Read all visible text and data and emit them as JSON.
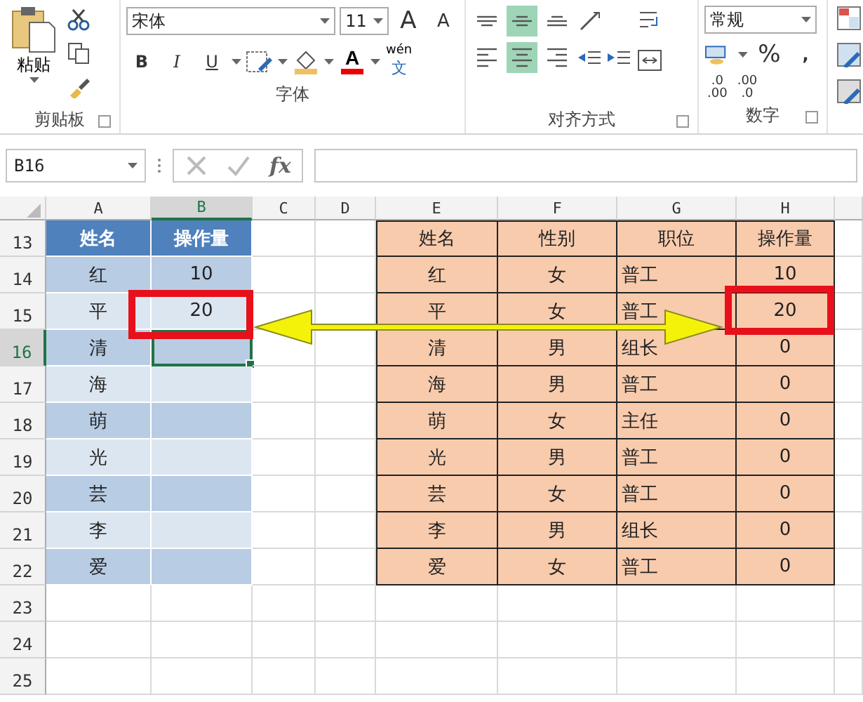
{
  "ribbon": {
    "clipboard": {
      "paste_label": "粘贴",
      "group_label": "剪贴板"
    },
    "font": {
      "font_name": "宋体",
      "font_size": "11",
      "grow": "A",
      "shrink": "A",
      "styles": [
        {
          "label": "B",
          "kind": "bold"
        },
        {
          "label": "I",
          "kind": "italic"
        },
        {
          "label": "U",
          "kind": "underline"
        }
      ],
      "font_color": "A",
      "phonetic": {
        "top": "wén",
        "bottom": "文"
      },
      "group_label": "字体"
    },
    "alignment": {
      "vertical": [
        {
          "kind": "top",
          "selected": false
        },
        {
          "kind": "middle",
          "selected": true
        },
        {
          "kind": "bottom",
          "selected": false
        }
      ],
      "horizontal": [
        {
          "kind": "left",
          "selected": false
        },
        {
          "kind": "center",
          "selected": true
        },
        {
          "kind": "right",
          "selected": false
        }
      ],
      "group_label": "对齐方式"
    },
    "number": {
      "format": "常规",
      "percent": "%",
      "comma": ",",
      "decimals": [
        {
          "top": ".0",
          "bottom": ".00"
        },
        {
          "top": ".00",
          "bottom": ".0"
        }
      ],
      "group_label": "数字"
    }
  },
  "formula_bar": {
    "name_box": "B16",
    "fx": "fx"
  },
  "sheet": {
    "columns": [
      {
        "label": "A",
        "selected": false
      },
      {
        "label": "B",
        "selected": true
      },
      {
        "label": "C",
        "selected": false
      },
      {
        "label": "D",
        "selected": false
      },
      {
        "label": "E",
        "selected": false
      },
      {
        "label": "F",
        "selected": false
      },
      {
        "label": "G",
        "selected": false
      },
      {
        "label": "H",
        "selected": false
      }
    ],
    "rows": [
      {
        "label": "13",
        "selected": false
      },
      {
        "label": "14",
        "selected": false
      },
      {
        "label": "15",
        "selected": false
      },
      {
        "label": "16",
        "selected": true
      },
      {
        "label": "17",
        "selected": false
      },
      {
        "label": "18",
        "selected": false
      },
      {
        "label": "19",
        "selected": false
      },
      {
        "label": "20",
        "selected": false
      },
      {
        "label": "21",
        "selected": false
      },
      {
        "label": "22",
        "selected": false
      },
      {
        "label": "23",
        "selected": false
      },
      {
        "label": "24",
        "selected": false
      },
      {
        "label": "25",
        "selected": false
      }
    ]
  },
  "left_table": {
    "columns": [
      "姓名",
      "操作量"
    ],
    "rows": [
      [
        "红",
        "10"
      ],
      [
        "平",
        "20"
      ],
      [
        "清"
      ],
      [
        "海"
      ],
      [
        "萌"
      ],
      [
        "光"
      ],
      [
        "芸"
      ],
      [
        "李"
      ],
      [
        "爱"
      ]
    ]
  },
  "right_table": {
    "columns": [
      "姓名",
      "性别",
      "职位",
      "操作量"
    ],
    "rows": [
      [
        "红",
        "女",
        "普工",
        "10"
      ],
      [
        "平",
        "女",
        "普工",
        "20"
      ],
      [
        "清",
        "男",
        "组长",
        "0"
      ],
      [
        "海",
        "男",
        "普工",
        "0"
      ],
      [
        "萌",
        "女",
        "主任",
        "0"
      ],
      [
        "光",
        "男",
        "普工",
        "0"
      ],
      [
        "芸",
        "女",
        "普工",
        "0"
      ],
      [
        "李",
        "男",
        "组长",
        "0"
      ],
      [
        "爱",
        "女",
        "普工",
        "0"
      ]
    ]
  }
}
